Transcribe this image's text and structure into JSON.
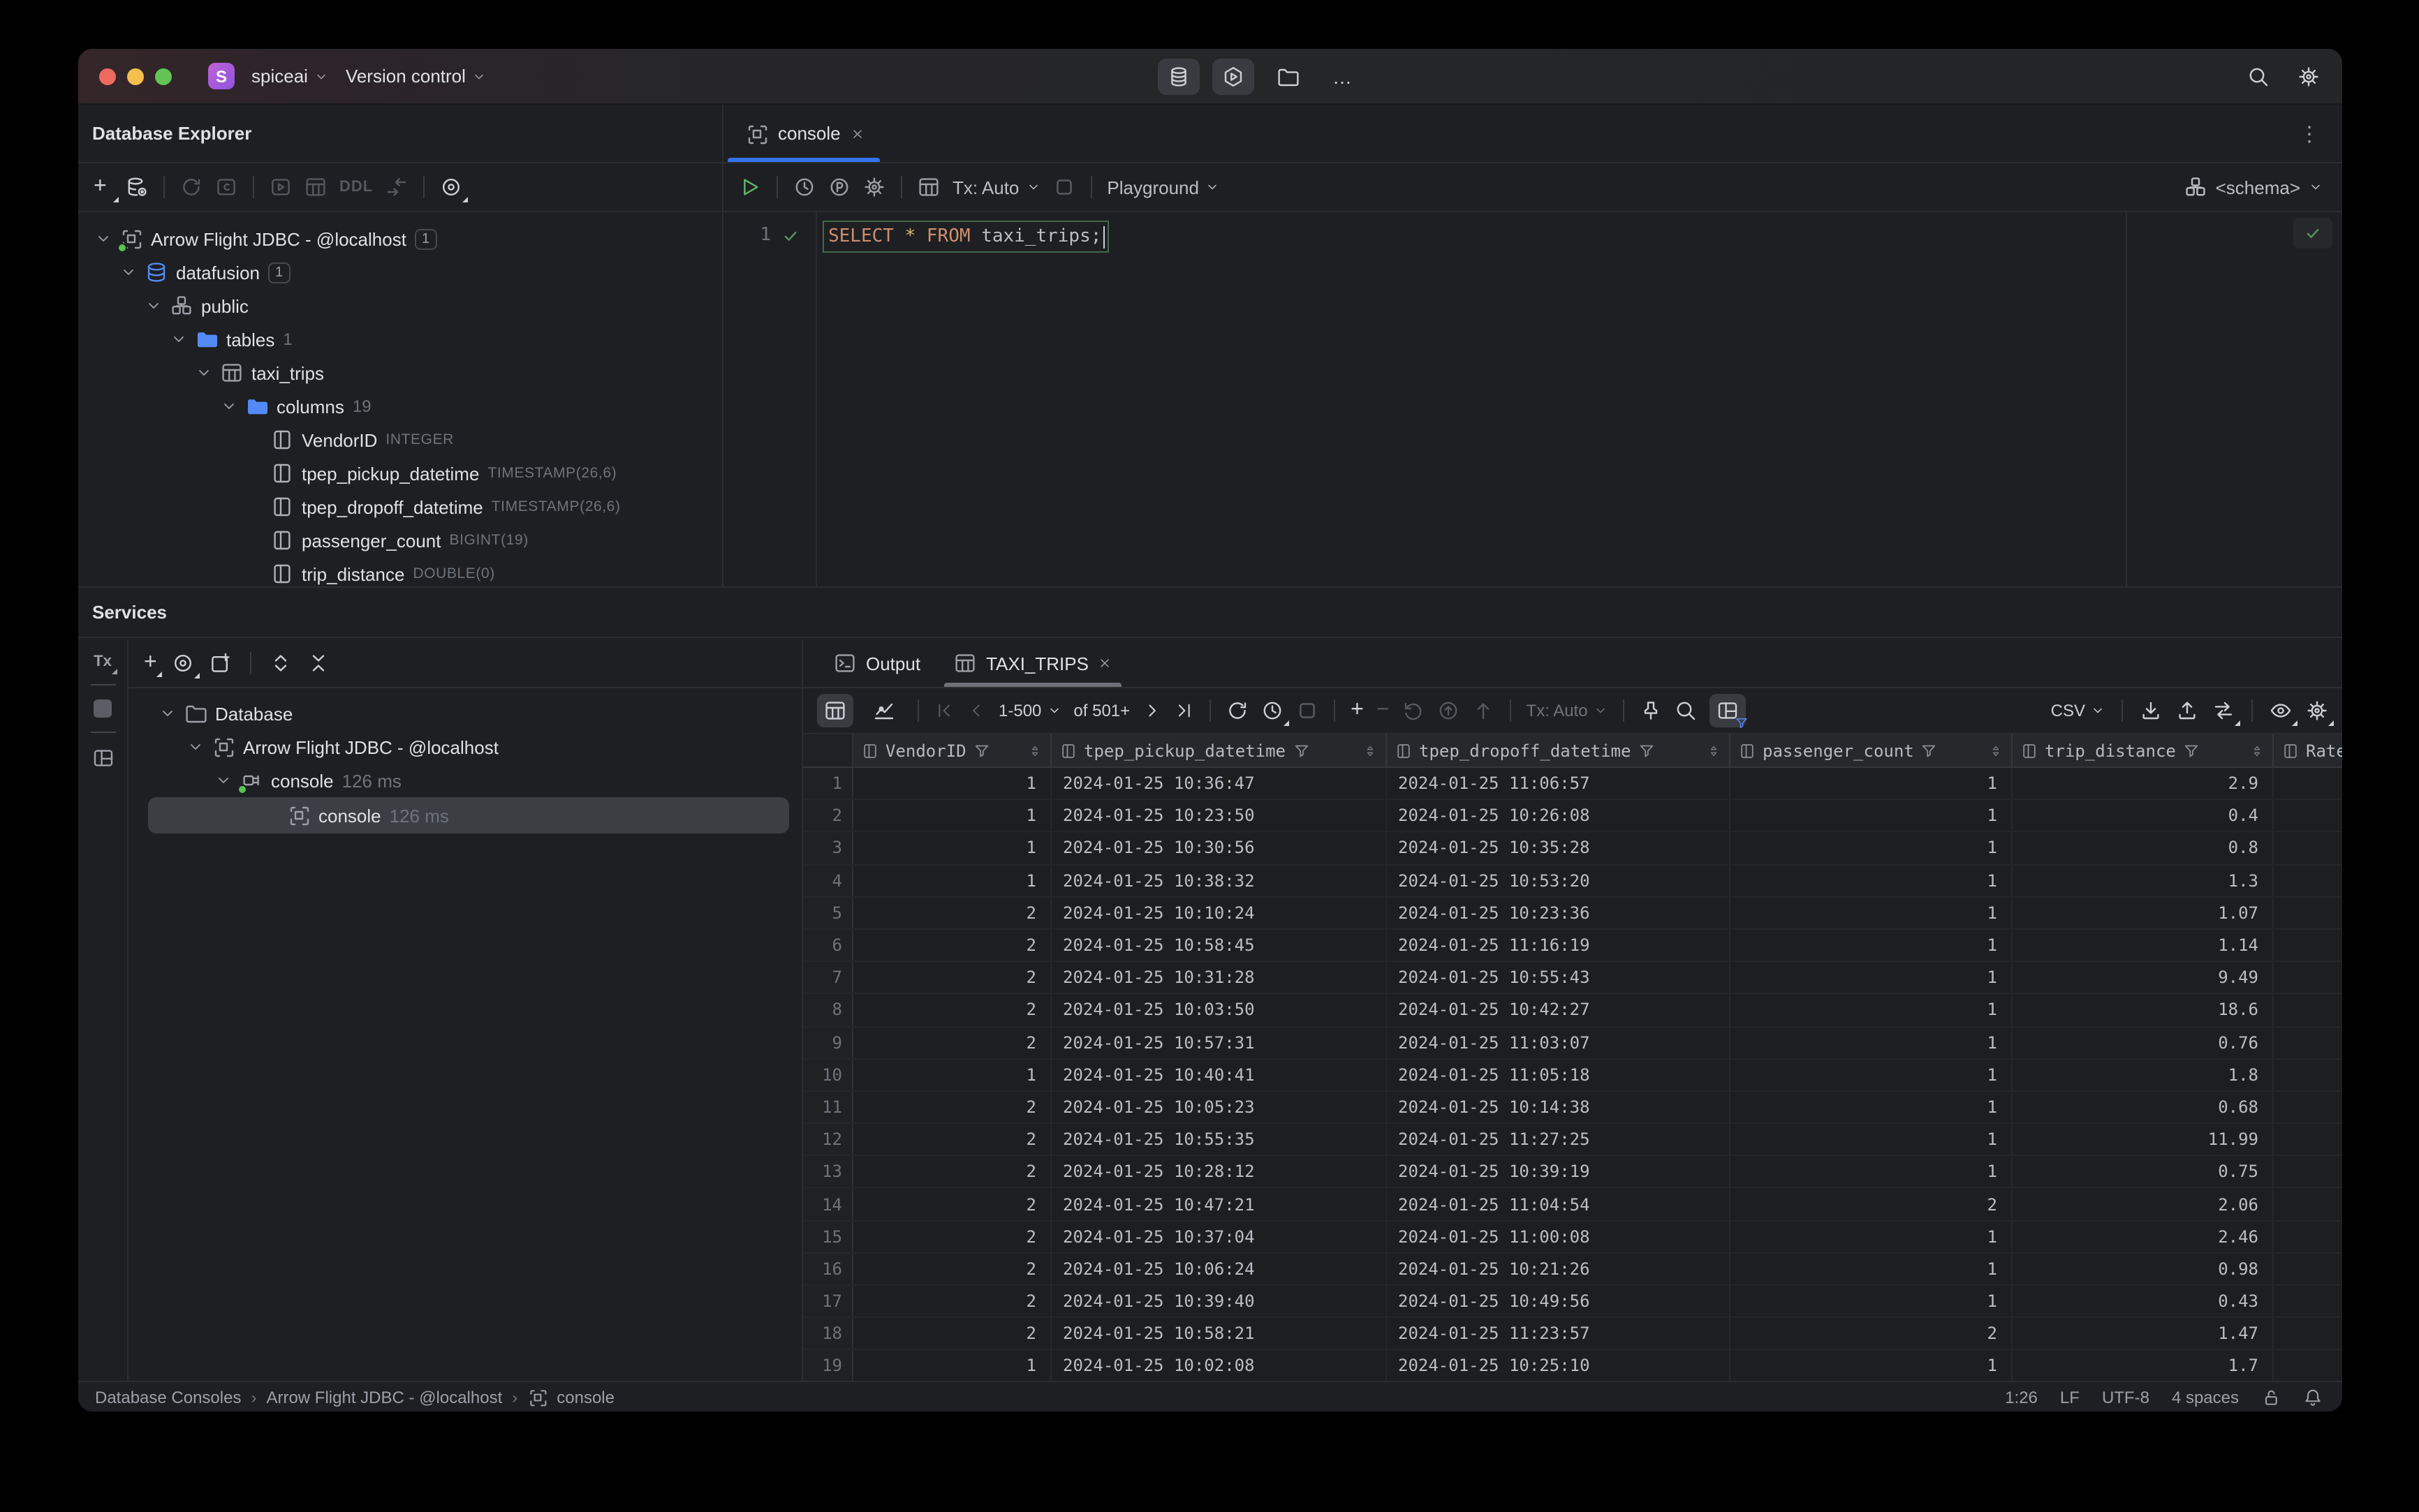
{
  "window": {
    "project_name": "spiceai",
    "menu_label": "Version control",
    "logo_letter": "S"
  },
  "icons": {
    "more_horizontal": "…",
    "kebab_menu": "⋮"
  },
  "explorer": {
    "title": "Database Explorer",
    "ddl_label": "DDL",
    "tree": [
      {
        "label": "Arrow Flight JDBC - @localhost",
        "badge": "1"
      },
      {
        "label": "datafusion",
        "badge": "1"
      },
      {
        "label": "public"
      },
      {
        "label": "tables",
        "count": "1"
      },
      {
        "label": "taxi_trips"
      },
      {
        "label": "columns",
        "count": "19"
      },
      {
        "label": "VendorID",
        "type": "INTEGER"
      },
      {
        "label": "tpep_pickup_datetime",
        "type": "TIMESTAMP(26,6)"
      },
      {
        "label": "tpep_dropoff_datetime",
        "type": "TIMESTAMP(26,6)"
      },
      {
        "label": "passenger_count",
        "type": "BIGINT(19)"
      },
      {
        "label": "trip_distance",
        "type": "DOUBLE(0)"
      }
    ]
  },
  "editor": {
    "tab_title": "console",
    "tx_mode": "Tx: Auto",
    "playground": "Playground",
    "schema_selector": "<schema>",
    "line_number": "1",
    "sql": {
      "select": "SELECT",
      "star": "*",
      "from": "FROM",
      "table": "taxi_trips",
      "semicolon": ";"
    }
  },
  "services": {
    "title": "Services",
    "tx_label": "Tx",
    "tree": [
      {
        "label": "Database"
      },
      {
        "label": "Arrow Flight JDBC - @localhost"
      },
      {
        "label": "console",
        "meta": "126 ms"
      },
      {
        "label": "console",
        "meta": "126 ms"
      }
    ]
  },
  "results": {
    "output_tab": "Output",
    "result_tab": "TAXI_TRIPS",
    "toolbar": {
      "page_range": "1-500",
      "page_total": "of 501+",
      "tx_mode": "Tx: Auto",
      "export_format": "CSV"
    },
    "grid": {
      "columns": [
        "VendorID",
        "tpep_pickup_datetime",
        "tpep_dropoff_datetime",
        "passenger_count",
        "trip_distance",
        "Rate"
      ],
      "rows": [
        {
          "n": "1",
          "vendor": "1",
          "pickup": "2024-01-25 10:36:47",
          "dropoff": "2024-01-25 11:06:57",
          "pax": "1",
          "dist": "2.9"
        },
        {
          "n": "2",
          "vendor": "1",
          "pickup": "2024-01-25 10:23:50",
          "dropoff": "2024-01-25 10:26:08",
          "pax": "1",
          "dist": "0.4"
        },
        {
          "n": "3",
          "vendor": "1",
          "pickup": "2024-01-25 10:30:56",
          "dropoff": "2024-01-25 10:35:28",
          "pax": "1",
          "dist": "0.8"
        },
        {
          "n": "4",
          "vendor": "1",
          "pickup": "2024-01-25 10:38:32",
          "dropoff": "2024-01-25 10:53:20",
          "pax": "1",
          "dist": "1.3"
        },
        {
          "n": "5",
          "vendor": "2",
          "pickup": "2024-01-25 10:10:24",
          "dropoff": "2024-01-25 10:23:36",
          "pax": "1",
          "dist": "1.07"
        },
        {
          "n": "6",
          "vendor": "2",
          "pickup": "2024-01-25 10:58:45",
          "dropoff": "2024-01-25 11:16:19",
          "pax": "1",
          "dist": "1.14"
        },
        {
          "n": "7",
          "vendor": "2",
          "pickup": "2024-01-25 10:31:28",
          "dropoff": "2024-01-25 10:55:43",
          "pax": "1",
          "dist": "9.49"
        },
        {
          "n": "8",
          "vendor": "2",
          "pickup": "2024-01-25 10:03:50",
          "dropoff": "2024-01-25 10:42:27",
          "pax": "1",
          "dist": "18.6"
        },
        {
          "n": "9",
          "vendor": "2",
          "pickup": "2024-01-25 10:57:31",
          "dropoff": "2024-01-25 11:03:07",
          "pax": "1",
          "dist": "0.76"
        },
        {
          "n": "10",
          "vendor": "1",
          "pickup": "2024-01-25 10:40:41",
          "dropoff": "2024-01-25 11:05:18",
          "pax": "1",
          "dist": "1.8"
        },
        {
          "n": "11",
          "vendor": "2",
          "pickup": "2024-01-25 10:05:23",
          "dropoff": "2024-01-25 10:14:38",
          "pax": "1",
          "dist": "0.68"
        },
        {
          "n": "12",
          "vendor": "2",
          "pickup": "2024-01-25 10:55:35",
          "dropoff": "2024-01-25 11:27:25",
          "pax": "1",
          "dist": "11.99"
        },
        {
          "n": "13",
          "vendor": "2",
          "pickup": "2024-01-25 10:28:12",
          "dropoff": "2024-01-25 10:39:19",
          "pax": "1",
          "dist": "0.75"
        },
        {
          "n": "14",
          "vendor": "2",
          "pickup": "2024-01-25 10:47:21",
          "dropoff": "2024-01-25 11:04:54",
          "pax": "2",
          "dist": "2.06"
        },
        {
          "n": "15",
          "vendor": "2",
          "pickup": "2024-01-25 10:37:04",
          "dropoff": "2024-01-25 11:00:08",
          "pax": "1",
          "dist": "2.46"
        },
        {
          "n": "16",
          "vendor": "2",
          "pickup": "2024-01-25 10:06:24",
          "dropoff": "2024-01-25 10:21:26",
          "pax": "1",
          "dist": "0.98"
        },
        {
          "n": "17",
          "vendor": "2",
          "pickup": "2024-01-25 10:39:40",
          "dropoff": "2024-01-25 10:49:56",
          "pax": "1",
          "dist": "0.43"
        },
        {
          "n": "18",
          "vendor": "2",
          "pickup": "2024-01-25 10:58:21",
          "dropoff": "2024-01-25 11:23:57",
          "pax": "2",
          "dist": "1.47"
        },
        {
          "n": "19",
          "vendor": "1",
          "pickup": "2024-01-25 10:02:08",
          "dropoff": "2024-01-25 10:25:10",
          "pax": "1",
          "dist": "1.7"
        }
      ]
    }
  },
  "status": {
    "crumb1": "Database Consoles",
    "crumb2": "Arrow Flight JDBC - @localhost",
    "crumb3": "console",
    "crumb_sep": "›",
    "caret": "1:26",
    "line_sep": "LF",
    "encoding": "UTF-8",
    "indent": "4 spaces"
  }
}
